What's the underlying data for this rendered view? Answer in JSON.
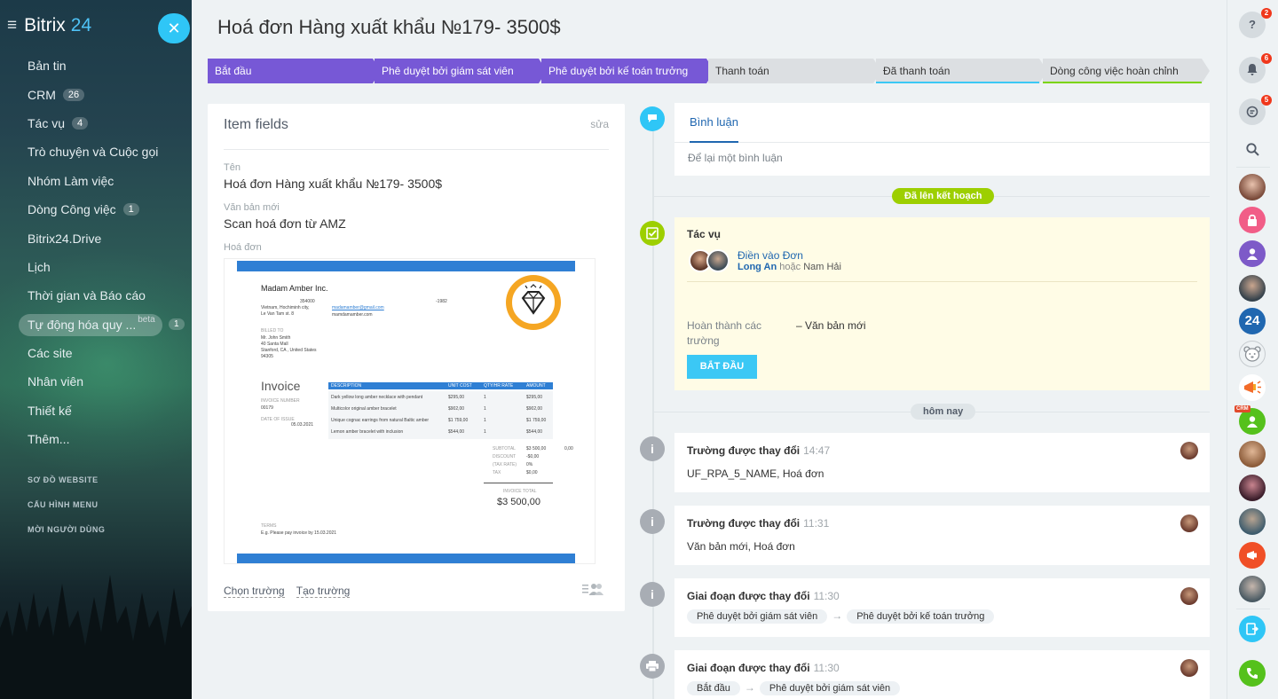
{
  "app": {
    "name": "Bitrix",
    "name_suffix": "24"
  },
  "sidebar": {
    "items": [
      {
        "label": "Bản tin"
      },
      {
        "label": "CRM",
        "badge": "26"
      },
      {
        "label": "Tác vụ",
        "badge": "4"
      },
      {
        "label": "Trò chuyện và Cuộc gọi"
      },
      {
        "label": "Nhóm Làm việc"
      },
      {
        "label": "Dòng Công việc",
        "badge": "1"
      },
      {
        "label": "Bitrix24.Drive"
      },
      {
        "label": "Lịch"
      },
      {
        "label": "Thời gian và Báo cáo"
      },
      {
        "label": "Tự động hóa quy ...",
        "tag": "beta",
        "badge": "1",
        "active": true
      },
      {
        "label": "Các site"
      },
      {
        "label": "Nhân viên"
      },
      {
        "label": "Thiết kế"
      },
      {
        "label": "Thêm..."
      }
    ],
    "small": [
      "SƠ ĐỒ WEBSITE",
      "CẤU HÌNH MENU",
      "MỜI NGƯỜI DÙNG"
    ]
  },
  "page": {
    "title": "Hoá đơn Hàng xuất khẩu №179- 3500$"
  },
  "stages": [
    {
      "label": "Bắt đầu",
      "state": "done"
    },
    {
      "label": "Phê duyệt bởi giám sát viên",
      "state": "done"
    },
    {
      "label": "Phê duyệt bởi kế toán trưởng",
      "state": "done"
    },
    {
      "label": "Thanh toán",
      "state": "pending"
    },
    {
      "label": "Đã thanh toán",
      "state": "pending",
      "underline": "#3bc8f5"
    },
    {
      "label": "Dòng công việc hoàn chỉnh",
      "state": "pending",
      "underline": "#7bd500"
    }
  ],
  "item_fields": {
    "title": "Item fields",
    "edit": "sửa",
    "fields": [
      {
        "label": "Tên",
        "value": "Hoá đơn Hàng xuất khẩu №179- 3500$"
      },
      {
        "label": "Văn bản mới",
        "value": "Scan hoá đơn từ AMZ"
      },
      {
        "label": "Hoá đơn",
        "value": ""
      }
    ],
    "link_select": "Chọn trường",
    "link_create": "Tạo trường"
  },
  "invoice": {
    "company": "Madam Amber Inc.",
    "address": [
      "354000",
      "Vietnam, Hochiminh city,",
      "Le Van Tam st. 8"
    ],
    "phone": "-1982",
    "email": "madamamber@gmail.com",
    "site": "mamdamamber.com",
    "billed_to_label": "BILLED TO",
    "billed_to": [
      "Mr. John Smith",
      "40 Santa Mall",
      "Stanford, CA , United States",
      "94305"
    ],
    "heading": "Invoice",
    "inv_num_label": "INVOICE NUMBER",
    "inv_num": "00179",
    "date_label": "DATE OF ISSUE",
    "date": "05.03.2021",
    "columns": [
      "DESCRIPTION",
      "UNIT COST",
      "QTY/HR RATE",
      "AMOUNT"
    ],
    "rows": [
      [
        "Dark yellow long amber necklace with pendant",
        "$295,00",
        "1",
        "$295,00"
      ],
      [
        "Multicolor original amber bracelet",
        "$902,00",
        "1",
        "$902,00"
      ],
      [
        "Unique cognac earrings from natural Baltic amber",
        "$1 759,00",
        "1",
        "$1 759,00"
      ],
      [
        "Lemon amber bracelet with inclusion",
        "$544,00",
        "1",
        "$544,00"
      ]
    ],
    "totals": [
      [
        "SUBTOTAL",
        "$3 500,00",
        "0,00"
      ],
      [
        "DISCOUNT",
        "-$0,00",
        ""
      ],
      [
        "(TAX RATE)",
        "0%",
        ""
      ],
      [
        "TAX",
        "$0,00",
        ""
      ]
    ],
    "total_label": "INVOICE TOTAL",
    "total": "$3 500,00",
    "terms_label": "TERMS",
    "terms": "E.g. Please pay invoice by 15.03.2021"
  },
  "timeline": {
    "comment_tab": "Bình luận",
    "comment_placeholder": "Để lại một bình luận",
    "planned_label": "Đã lên kết hoạch",
    "today_label": "hôm nay",
    "task": {
      "title": "Tác vụ",
      "link": "Điền vào Đơn",
      "assignee": "Long An",
      "or": "hoặc",
      "alt": "Nam Hải",
      "field_label": "Hoàn thành các trường",
      "field_value": "– Văn bản mới",
      "button": "BẮT ĐẦU"
    },
    "events": [
      {
        "title": "Trường được thay đổi",
        "time": "14:47",
        "body": "UF_RPA_5_NAME, Hoá đơn"
      },
      {
        "title": "Trường được thay đổi",
        "time": "11:31",
        "body": "Văn bản mới, Hoá đơn"
      },
      {
        "title": "Giai đoạn được thay đổi",
        "time": "11:30",
        "from": "Phê duyệt bởi giám sát viên",
        "to": "Phê duyệt bởi kế toán trưởng"
      },
      {
        "title": "Giai đoạn được thay đổi",
        "time": "11:30",
        "from": "Bắt đầu",
        "to": "Phê duyệt bởi giám sát viên"
      }
    ]
  },
  "right_bar": {
    "help_count": "2",
    "notif_count": "6",
    "chat_count": "5",
    "crm_tag": "CRM",
    "b24_label": "24"
  },
  "colors": {
    "accent": "#2fc6f6",
    "stage_done": "#7758d6",
    "planned": "#9dcf00",
    "link": "#2067b0"
  }
}
